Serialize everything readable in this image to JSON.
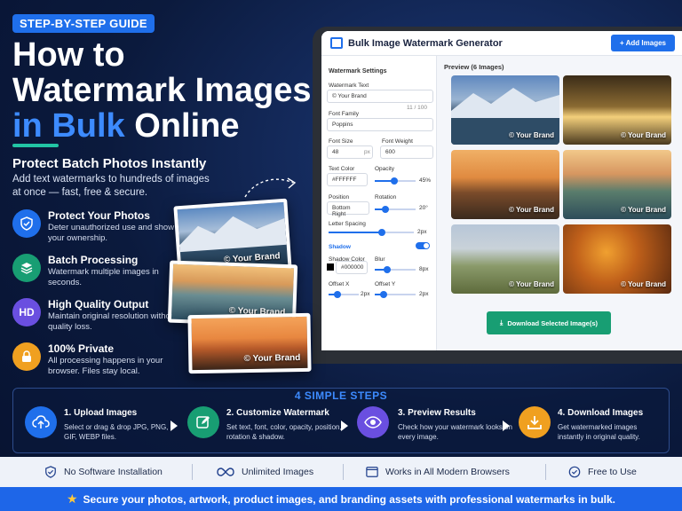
{
  "hero": {
    "badge": "STEP-BY-STEP GUIDE",
    "title_line1": "How to",
    "title_line2": "Watermark Images",
    "title_line3_blue": "in Bulk",
    "title_line3_white": " Online",
    "subtitle": "Protect Batch Photos Instantly",
    "description": "Add text watermarks to hundreds of images at once — fast, free & secure."
  },
  "features": [
    {
      "icon": "shield-check-icon",
      "title": "Protect Your Photos",
      "desc": "Deter unauthorized use and show your ownership.",
      "color": "#1f6feb"
    },
    {
      "icon": "layers-icon",
      "title": "Batch Processing",
      "desc": "Watermark multiple images in seconds.",
      "color": "#189e73"
    },
    {
      "icon": "hd-icon",
      "icon_text": "HD",
      "title": "High Quality Output",
      "desc": "Maintain original resolution without quality loss.",
      "color": "#6a4fe0"
    },
    {
      "icon": "lock-icon",
      "title": "100% Private",
      "desc": "All processing happens in your browser. Files stay local.",
      "color": "#f0a020"
    }
  ],
  "app": {
    "title": "Bulk Image Watermark Generator",
    "add_button": "+ Add Images",
    "settings_title": "Watermark Settings",
    "watermark_text_label": "Watermark Text",
    "watermark_text_value": "© Your Brand",
    "char_count": "11 / 100",
    "font_family_label": "Font Family",
    "font_family_value": "Poppins",
    "font_size_label": "Font Size",
    "font_size_value": "48",
    "font_size_unit": "px",
    "font_weight_label": "Font Weight",
    "font_weight_value": "600",
    "text_color_label": "Text Color",
    "text_color_value": "#FFFFFF",
    "opacity_label": "Opacity",
    "opacity_value": "45%",
    "position_label": "Position",
    "position_value": "Bottom Right",
    "rotation_label": "Rotation",
    "rotation_value": "20°",
    "letter_spacing_label": "Letter Spacing",
    "letter_spacing_value": "2px",
    "shadow_label": "Shadow",
    "shadow_color_label": "Shadow Color",
    "shadow_color_value": "#000000",
    "blur_label": "Blur",
    "blur_value": "8px",
    "offset_x_label": "Offset X",
    "offset_x_value": "2px",
    "offset_y_label": "Offset Y",
    "offset_y_value": "2px",
    "preview_title": "Preview (6 Images)",
    "watermark_sample": "© Your Brand",
    "download_button": "Download Selected Image(s)"
  },
  "floating_watermark": "© Your Brand",
  "steps": {
    "heading": "4 SIMPLE STEPS",
    "items": [
      {
        "title": "1. Upload Images",
        "desc": "Select or drag & drop JPG, PNG, GIF, WEBP files.",
        "color": "#1f6feb",
        "icon": "cloud-upload-icon"
      },
      {
        "title": "2. Customize Watermark",
        "desc": "Set text, font, color, opacity, position, rotation & shadow.",
        "color": "#189e73",
        "icon": "edit-icon"
      },
      {
        "title": "3. Preview Results",
        "desc": "Check how your watermark looks on every image.",
        "color": "#6a4fe0",
        "icon": "eye-icon"
      },
      {
        "title": "4. Download Images",
        "desc": "Get watermarked images instantly in original quality.",
        "color": "#f0a020",
        "icon": "download-icon"
      }
    ]
  },
  "benefits": [
    {
      "label": "No Software Installation",
      "icon": "shield-icon"
    },
    {
      "label": "Unlimited Images",
      "icon": "infinity-icon"
    },
    {
      "label": "Works in All Modern Browsers",
      "icon": "browser-icon"
    },
    {
      "label": "Free to Use",
      "icon": "check-circle-icon"
    }
  ],
  "footer": "Secure your photos, artwork, product images, and branding assets with professional watermarks in bulk."
}
